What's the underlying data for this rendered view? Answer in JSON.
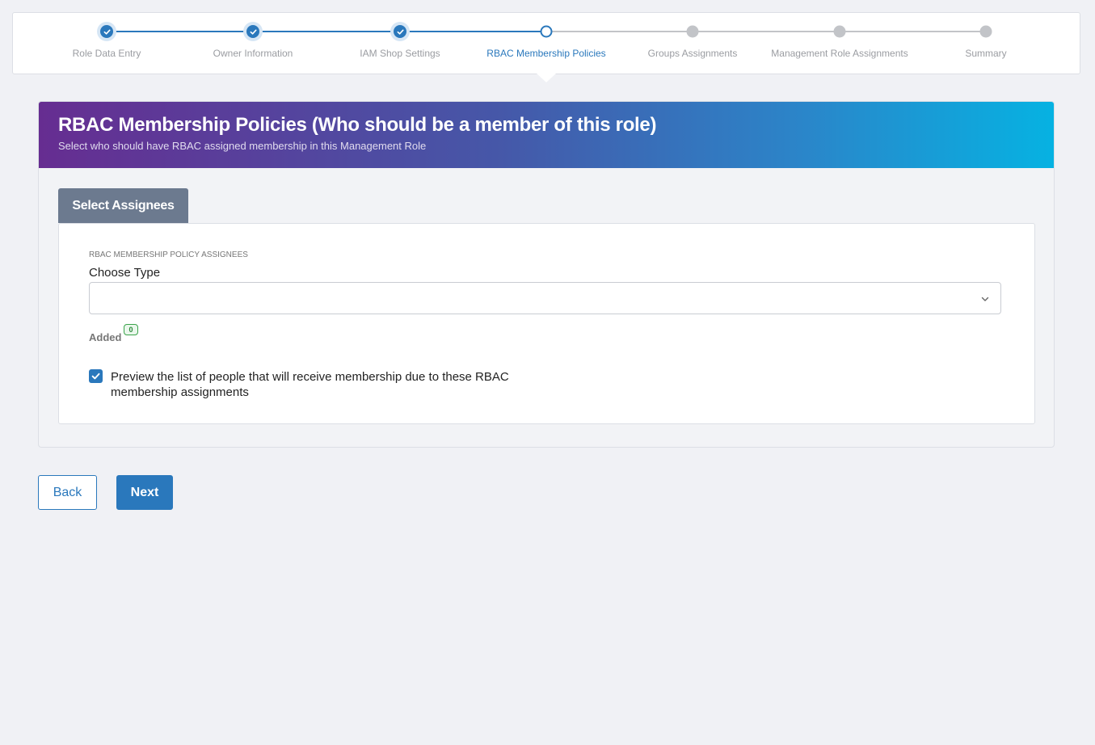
{
  "wizard": {
    "steps": [
      {
        "label": "Role Data Entry",
        "state": "done"
      },
      {
        "label": "Owner Information",
        "state": "done"
      },
      {
        "label": "IAM Shop Settings",
        "state": "done"
      },
      {
        "label": "RBAC Membership Policies",
        "state": "current"
      },
      {
        "label": "Groups Assignments",
        "state": "todo"
      },
      {
        "label": "Management Role Assignments",
        "state": "todo"
      },
      {
        "label": "Summary",
        "state": "todo"
      }
    ]
  },
  "banner": {
    "title": "RBAC Membership Policies (Who should be a member of this role)",
    "subtitle": "Select who should have RBAC assigned membership in this Management Role"
  },
  "tab": {
    "label": "Select Assignees"
  },
  "form": {
    "section_label": "RBAC MEMBERSHIP POLICY ASSIGNEES",
    "choose_type_label": "Choose Type",
    "choose_type_value": "",
    "added_label": "Added",
    "added_count": "0",
    "preview_checked": true,
    "preview_label": "Preview the list of people that will receive membership due to these RBAC membership assignments"
  },
  "actions": {
    "back_label": "Back",
    "next_label": "Next"
  },
  "colors": {
    "accent": "#2a78bc",
    "gradient_start": "#662d91",
    "gradient_end": "#06b2e2"
  }
}
